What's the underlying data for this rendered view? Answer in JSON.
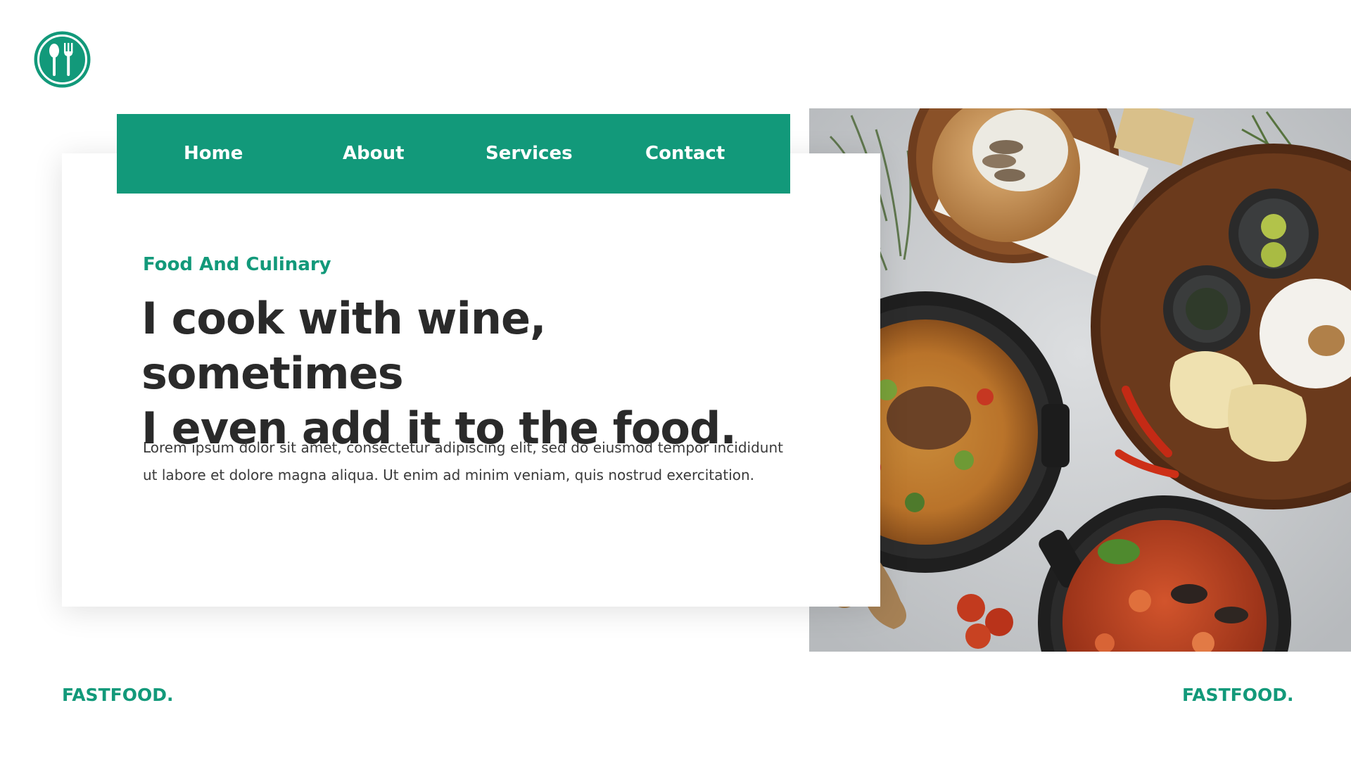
{
  "logo": {
    "icon": "spoon-fork-icon",
    "color": "#12997a"
  },
  "nav": {
    "items": [
      {
        "label": "Home"
      },
      {
        "label": "About"
      },
      {
        "label": "Services"
      },
      {
        "label": "Contact"
      }
    ],
    "background": "#12997a"
  },
  "hero": {
    "kicker": "Food And Culinary",
    "headline_line1": "I cook with wine, sometimes",
    "headline_line2": "I even add it to the food.",
    "body": "Lorem ipsum dolor sit amet, consectetur adipiscing elit, sed do eiusmod tempor incididunt ut labore et dolore magna aliqua. Ut enim ad minim veniam, quis nostrud exercitation."
  },
  "footer": {
    "brand_left": "FASTFOOD.",
    "brand_right": "FASTFOOD."
  },
  "colors": {
    "accent": "#12997a",
    "headline": "#2a2a2a",
    "body": "#3a3a3a"
  }
}
